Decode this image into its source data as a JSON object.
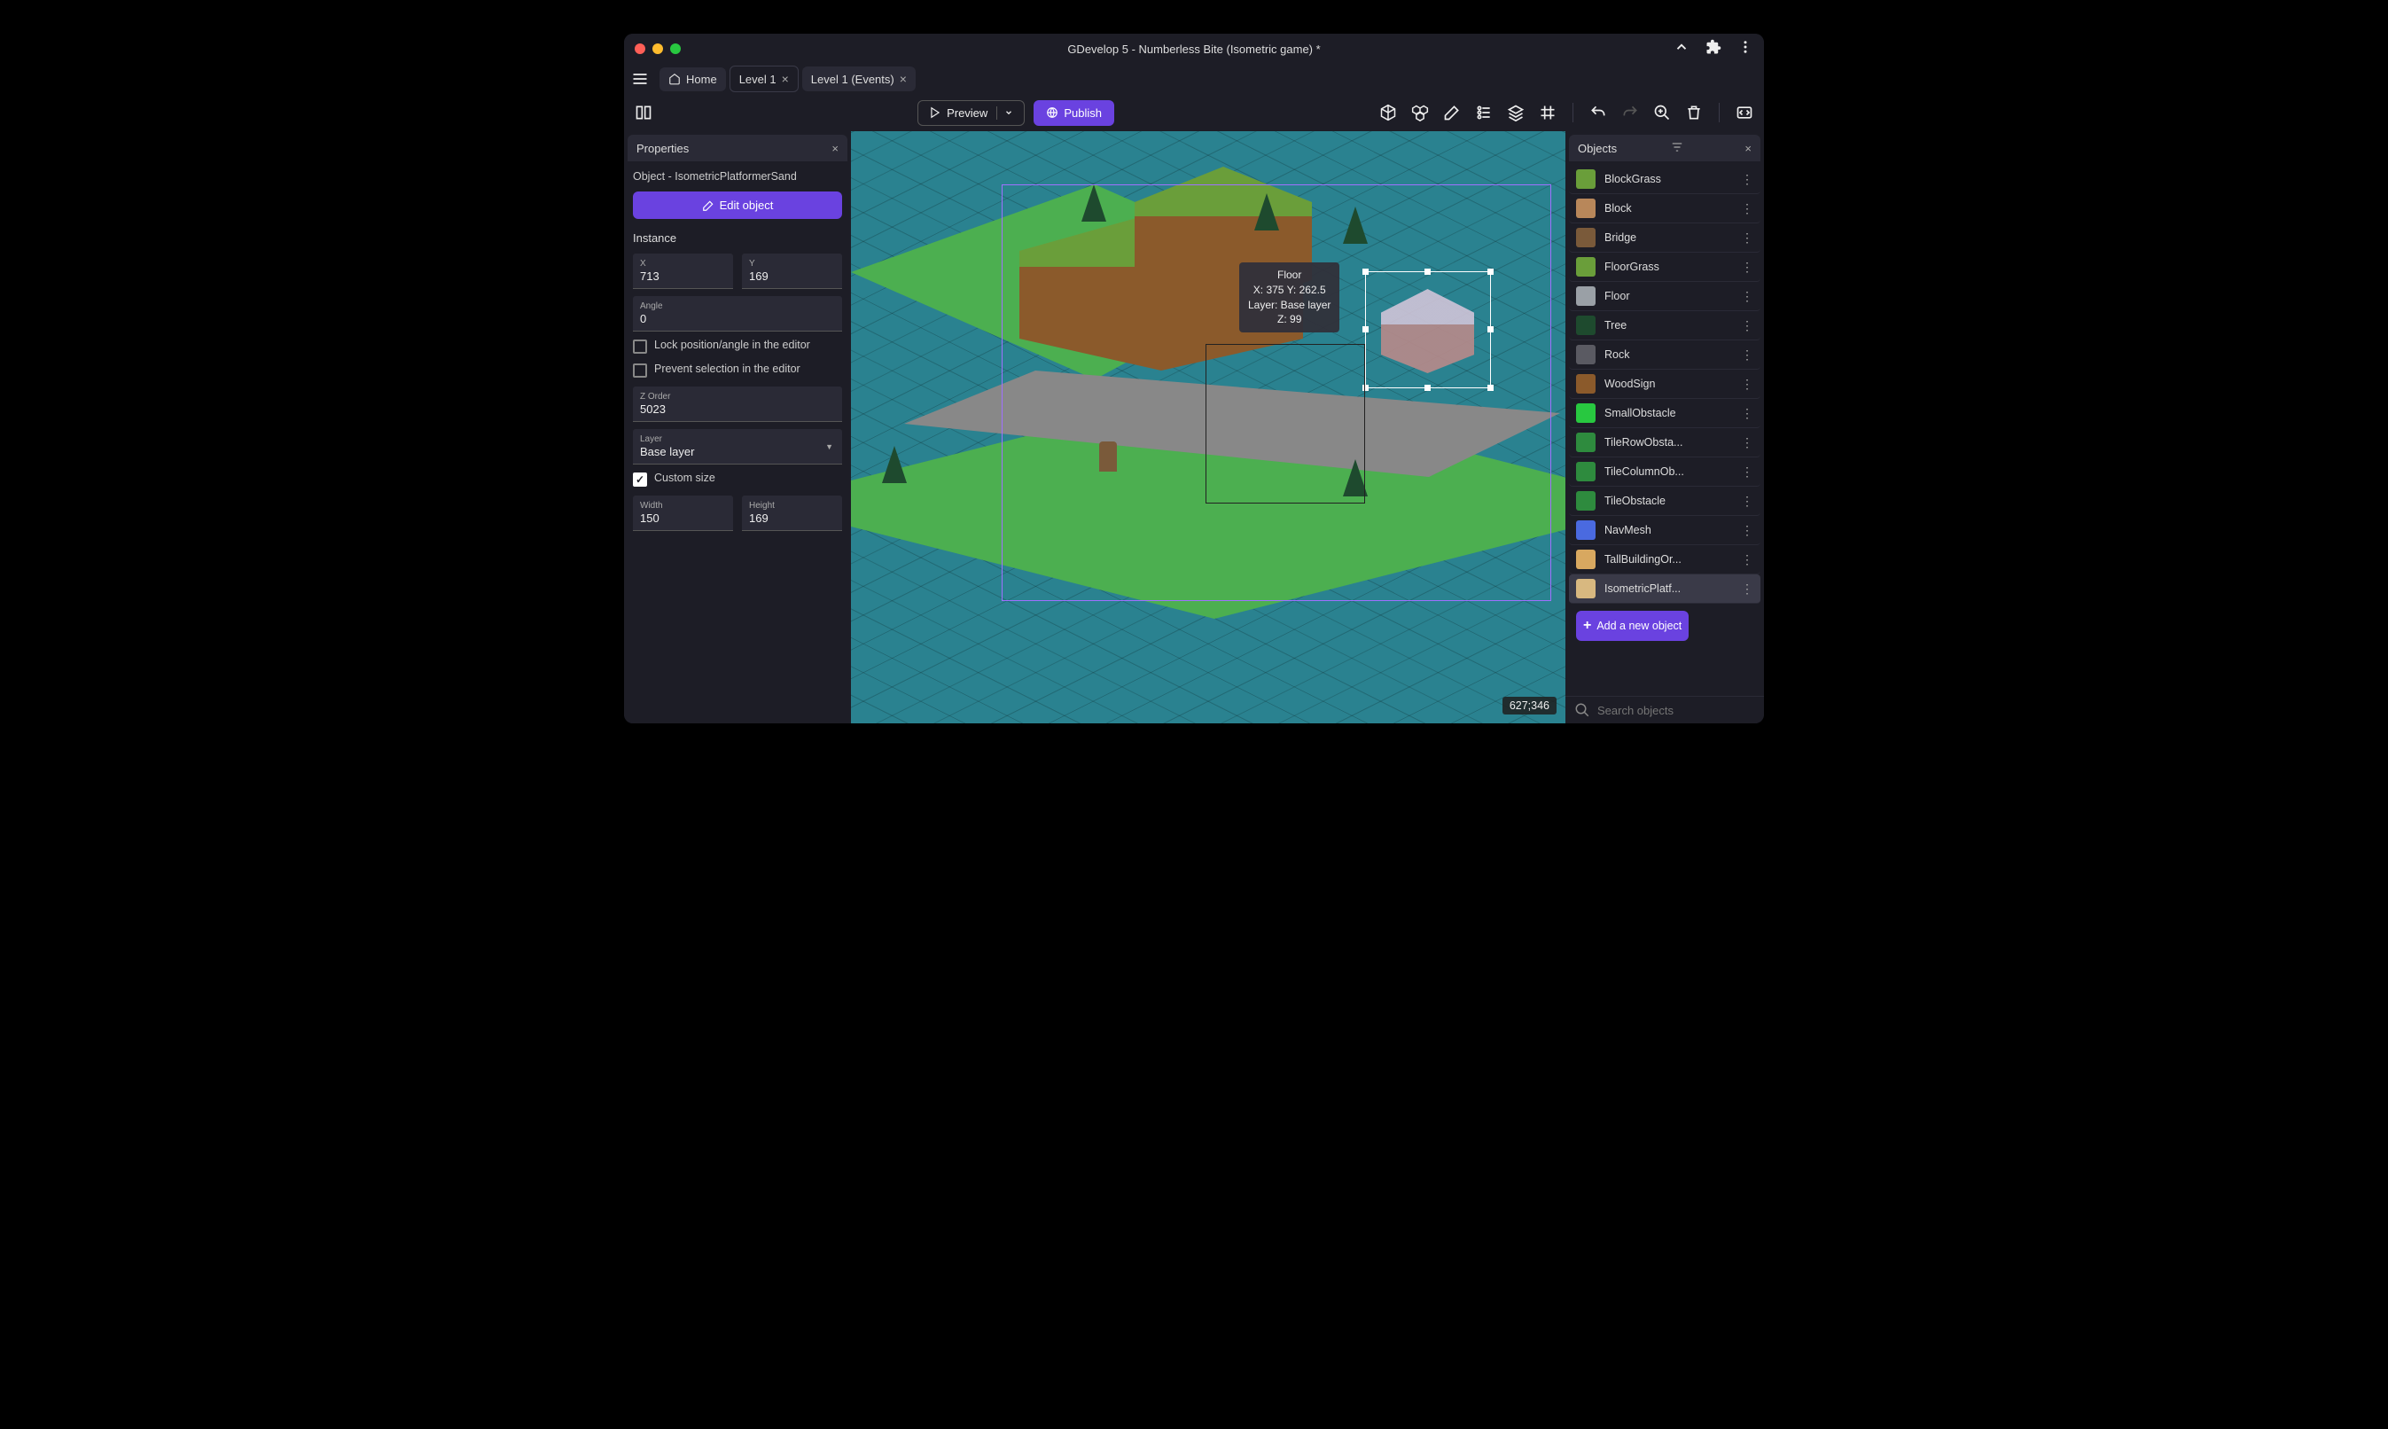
{
  "titlebar": {
    "title": "GDevelop 5 - Numberless Bite (Isometric game) *"
  },
  "tabs": [
    {
      "label": "Home",
      "active": false,
      "hasHome": true
    },
    {
      "label": "Level 1",
      "active": true,
      "closable": true
    },
    {
      "label": "Level 1 (Events)",
      "active": false,
      "closable": true
    }
  ],
  "toolbar": {
    "preview_label": "Preview",
    "publish_label": "Publish"
  },
  "properties": {
    "panel_title": "Properties",
    "object_line": "Object  -  IsometricPlatformerSand",
    "edit_button": "Edit object",
    "instance_label": "Instance",
    "x_label": "X",
    "x_value": "713",
    "y_label": "Y",
    "y_value": "169",
    "angle_label": "Angle",
    "angle_value": "0",
    "lock_label": "Lock position/angle in the editor",
    "lock_checked": false,
    "prevent_label": "Prevent selection in the editor",
    "prevent_checked": false,
    "zorder_label": "Z Order",
    "zorder_value": "5023",
    "layer_label": "Layer",
    "layer_value": "Base layer",
    "custom_size_label": "Custom size",
    "custom_size_checked": true,
    "width_label": "Width",
    "width_value": "150",
    "height_label": "Height",
    "height_value": "169"
  },
  "canvas": {
    "tooltip_name": "Floor",
    "tooltip_pos": "X: 375  Y: 262.5",
    "tooltip_layer": "Layer: Base layer",
    "tooltip_z": "Z: 99",
    "coords": "627;346"
  },
  "objects": {
    "panel_title": "Objects",
    "items": [
      {
        "label": "BlockGrass",
        "color": "#6a9e3a"
      },
      {
        "label": "Block",
        "color": "#b8875a"
      },
      {
        "label": "Bridge",
        "color": "#7a5a3a"
      },
      {
        "label": "FloorGrass",
        "color": "#6a9e3a"
      },
      {
        "label": "Floor",
        "color": "#9aa0a6"
      },
      {
        "label": "Tree",
        "color": "#1e4a2e"
      },
      {
        "label": "Rock",
        "color": "#5a5a62"
      },
      {
        "label": "WoodSign",
        "color": "#8b5a2b"
      },
      {
        "label": "SmallObstacle",
        "color": "#28c840"
      },
      {
        "label": "TileRowObsta...",
        "color": "#2e8b3e"
      },
      {
        "label": "TileColumnOb...",
        "color": "#2e8b3e"
      },
      {
        "label": "TileObstacle",
        "color": "#2e8b3e"
      },
      {
        "label": "NavMesh",
        "color": "#4a6ae0"
      },
      {
        "label": "TallBuildingOr...",
        "color": "#d8a860"
      },
      {
        "label": "IsometricPlatf...",
        "color": "#d8b880",
        "selected": true
      }
    ],
    "add_button": "Add a new object",
    "search_placeholder": "Search objects"
  }
}
